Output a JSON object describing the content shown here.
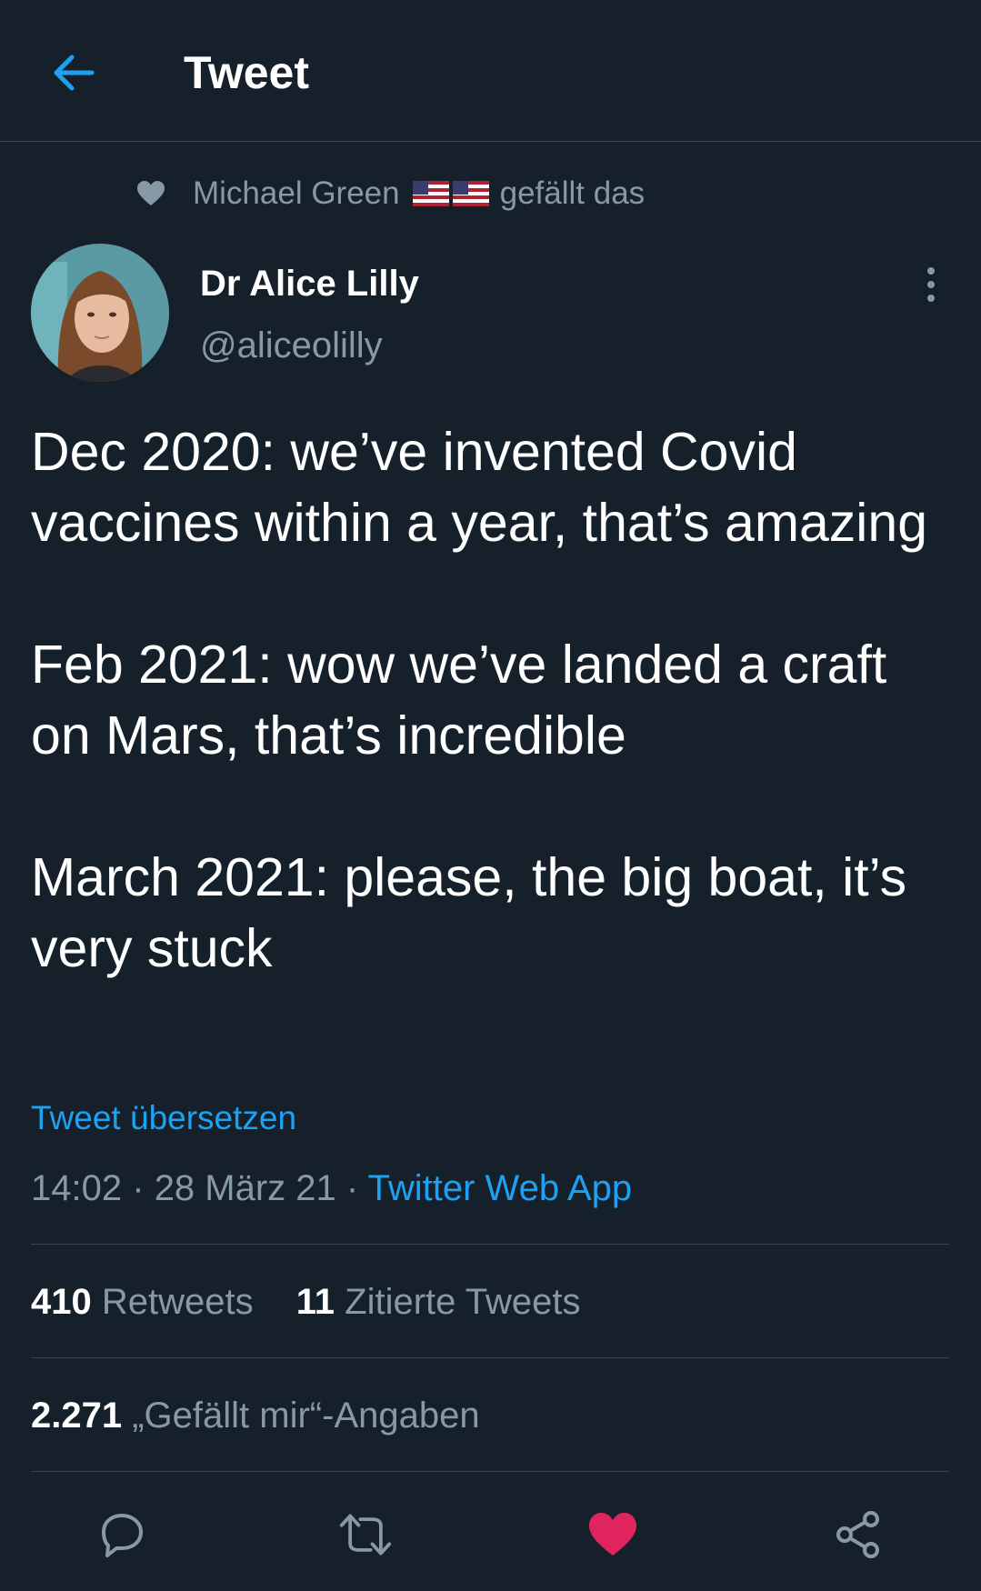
{
  "header": {
    "title": "Tweet"
  },
  "social_context": {
    "name": "Michael Green",
    "suffix": "gefällt das"
  },
  "author": {
    "name": "Dr Alice Lilly",
    "handle": "@aliceolilly"
  },
  "tweet": {
    "text": "Dec 2020: we’ve invented Covid vaccines within a year, that’s amazing\n\nFeb 2021: wow we’ve landed a craft on Mars, that’s incredible\n\nMarch 2021: please, the big boat, it’s very stuck",
    "translate_label": "Tweet übersetzen",
    "time": "14:02",
    "date": "28 März 21",
    "separator": "·",
    "source": "Twitter Web App"
  },
  "stats": {
    "retweets_count": "410",
    "retweets_label": "Retweets",
    "quotes_count": "11",
    "quotes_label": "Zitierte Tweets",
    "likes_count": "2.271",
    "likes_label": "„Gefällt mir“-Angaben"
  },
  "colors": {
    "background": "#15202b",
    "accent": "#1da1f2",
    "muted": "#8899a6",
    "like_active": "#e0245e",
    "divider": "#38444d"
  },
  "icons": {
    "back": "arrow-left-icon",
    "more": "more-vertical-icon",
    "reply": "reply-icon",
    "retweet": "retweet-icon",
    "like": "heart-filled-icon",
    "share": "share-icon"
  }
}
